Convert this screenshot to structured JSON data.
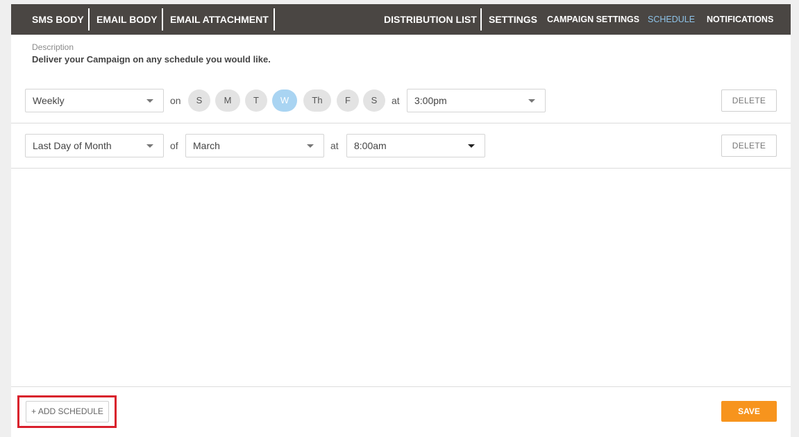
{
  "nav": {
    "left": [
      "SMS BODY",
      "EMAIL BODY",
      "EMAIL ATTACHMENT"
    ],
    "right": [
      "DISTRIBUTION LIST",
      "SETTINGS",
      "CAMPAIGN SETTINGS",
      "SCHEDULE",
      "NOTIFICATIONS"
    ],
    "active": "SCHEDULE",
    "colors": {
      "bar": "#4a4643",
      "active": "#8ec3e8"
    }
  },
  "description": {
    "label": "Description",
    "text": "Deliver your Campaign on any schedule you would like."
  },
  "schedules": [
    {
      "frequency": "Weekly",
      "on_label": "on",
      "days": [
        "S",
        "M",
        "T",
        "W",
        "Th",
        "F",
        "S"
      ],
      "selected_day": "W",
      "at_label": "at",
      "time": "3:00pm",
      "delete_label": "DELETE"
    },
    {
      "frequency": "Last Day of Month",
      "of_label": "of",
      "month": "March",
      "at_label": "at",
      "time": "8:00am",
      "delete_label": "DELETE"
    }
  ],
  "footer": {
    "add_label": "+ ADD SCHEDULE",
    "save_label": "SAVE",
    "colors": {
      "save": "#f7941d",
      "highlight": "#d9202c"
    }
  }
}
